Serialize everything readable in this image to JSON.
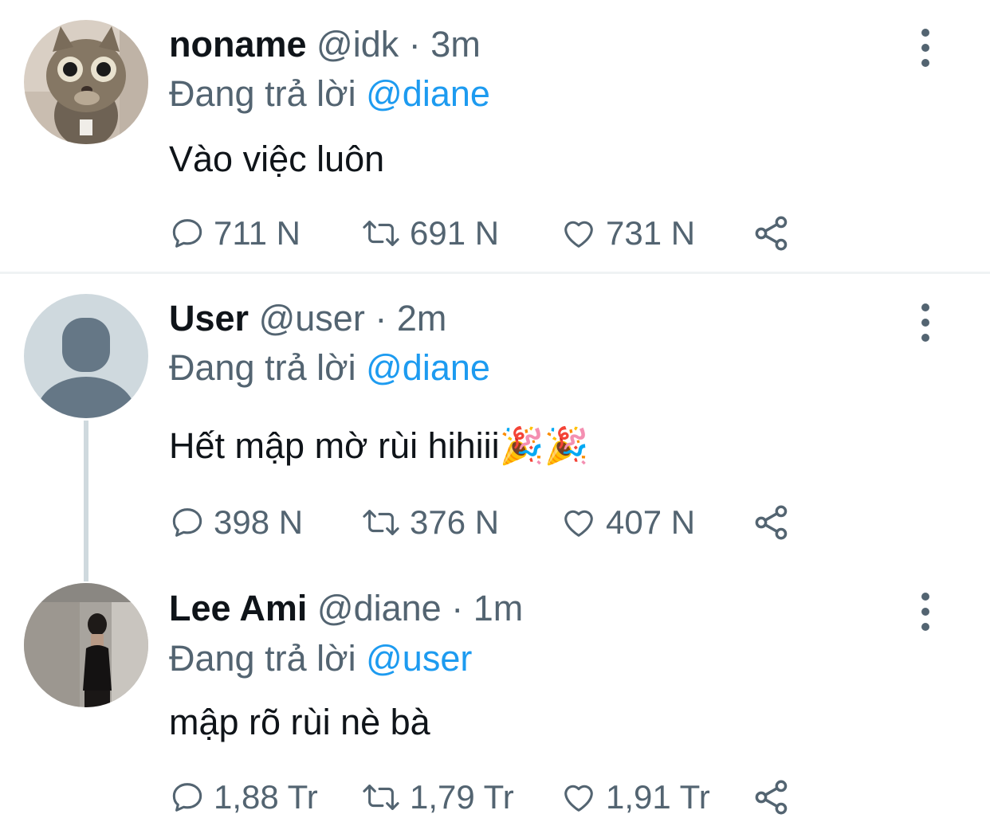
{
  "tweets": [
    {
      "name": "noname",
      "handle": "@idk",
      "separator": "·",
      "time": "3m",
      "replying_prefix": "Đang trả lời",
      "replying_to": "@diane",
      "text": "Vào việc luôn",
      "replies": "711 N",
      "retweets": "691 N",
      "likes": "731 N",
      "avatar": "cat-photo"
    },
    {
      "name": "User",
      "handle": "@user",
      "separator": "·",
      "time": "2m",
      "replying_prefix": "Đang trả lời",
      "replying_to": "@diane",
      "text": "Hết mập mờ rùi hihiii",
      "emoji": "🎉🎉",
      "replies": "398 N",
      "retweets": "376 N",
      "likes": "407 N",
      "avatar": "default-user"
    },
    {
      "name": "Lee Ami",
      "handle": "@diane",
      "separator": "·",
      "time": "1m",
      "replying_prefix": "Đang trả lời",
      "replying_to": "@user",
      "text": "mập rõ rùi nè bà",
      "replies": "1,88 Tr",
      "retweets": "1,79 Tr",
      "likes": "1,91 Tr",
      "avatar": "woman-photo"
    }
  ],
  "colors": {
    "accent": "#1d9bf0",
    "secondary_text": "#536471",
    "primary_text": "#0f1419"
  }
}
